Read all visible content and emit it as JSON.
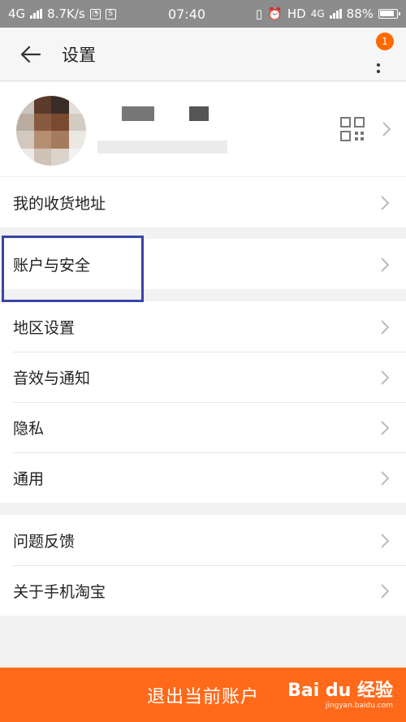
{
  "status_bar": {
    "network_type": "4G",
    "speed": "8.7K/s",
    "time": "07:40",
    "hd": "HD",
    "network_type2": "4G",
    "battery": "88%"
  },
  "header": {
    "title": "设置",
    "notification_count": "1"
  },
  "menu": {
    "group1": [
      {
        "label": "我的收货地址"
      }
    ],
    "group2": [
      {
        "label": "账户与安全"
      }
    ],
    "group3": [
      {
        "label": "地区设置"
      },
      {
        "label": "音效与通知"
      },
      {
        "label": "隐私"
      },
      {
        "label": "通用"
      }
    ],
    "group4": [
      {
        "label": "问题反馈"
      },
      {
        "label": "关于手机淘宝"
      }
    ]
  },
  "logout": {
    "label": "退出当前账户"
  },
  "watermark": {
    "logo": "Bai du 经验",
    "url": "jingyan.baidu.com"
  },
  "colors": {
    "accent": "#ff6a1a",
    "highlight_box": "#3a44a8",
    "badge": "#ff6a00"
  }
}
